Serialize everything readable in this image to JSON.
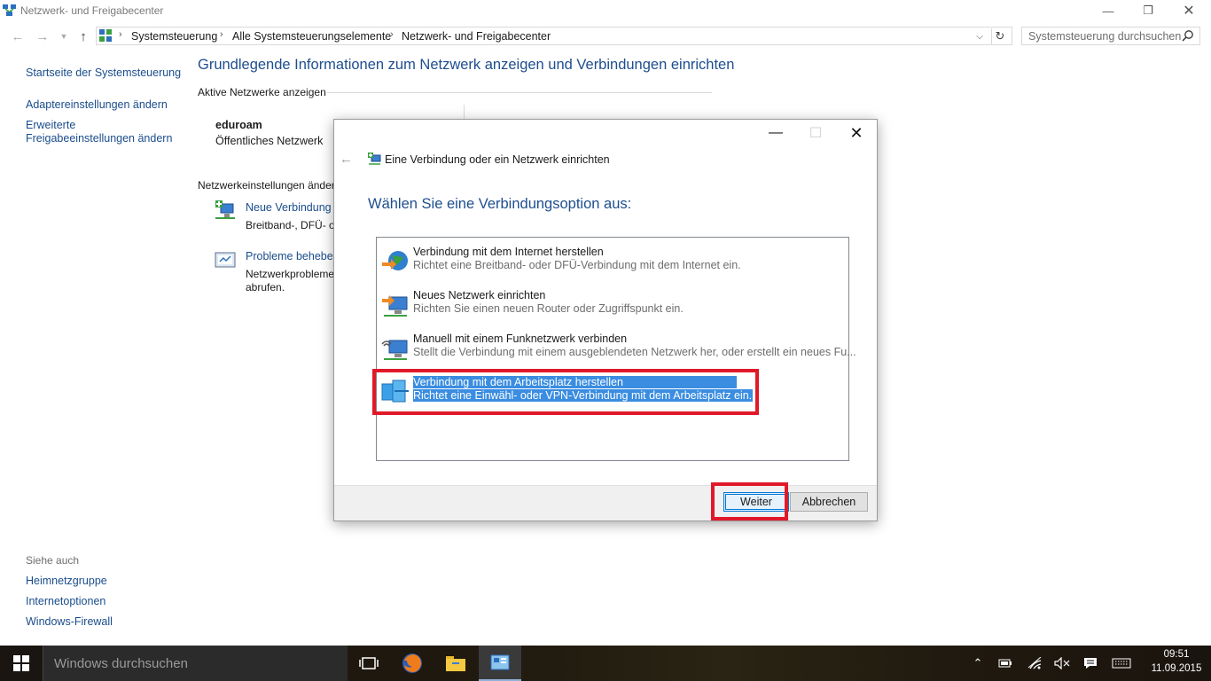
{
  "window": {
    "title": "Netzwerk- und Freigabecenter"
  },
  "address": {
    "crumbs": [
      "Systemsteuerung",
      "Alle Systemsteuerungselemente",
      "Netzwerk- und Freigabecenter"
    ],
    "search_placeholder": "Systemsteuerung durchsuchen"
  },
  "left_pane": {
    "home": "Startseite der Systemsteuerung",
    "adapter": "Adaptereinstellungen ändern",
    "advanced_line1": "Erweiterte",
    "advanced_line2": "Freigabeeinstellungen ändern",
    "see_also": "Siehe auch",
    "homegroup": "Heimnetzgruppe",
    "internet_options": "Internetoptionen",
    "firewall": "Windows-Firewall"
  },
  "main": {
    "title": "Grundlegende Informationen zum Netzwerk anzeigen und Verbindungen einrichten",
    "active_networks": "Aktive Netzwerke anzeigen",
    "network_name": "eduroam",
    "network_type": "Öffentliches Netzwerk",
    "settings_label": "Netzwerkeinstellungen änder",
    "new_conn_link": "Neue Verbindung o",
    "new_conn_desc": "Breitband-, DFÜ- o",
    "trouble_link": "Probleme beheben",
    "trouble_desc1": "Netzwerkprobleme",
    "trouble_desc2": "abrufen."
  },
  "dialog": {
    "title": "Eine Verbindung oder ein Netzwerk einrichten",
    "heading": "Wählen Sie eine Verbindungsoption aus:",
    "options": [
      {
        "title": "Verbindung mit dem Internet herstellen",
        "desc": "Richtet eine Breitband- oder DFÜ-Verbindung mit dem Internet ein.",
        "icon": "globe-icon"
      },
      {
        "title": "Neues Netzwerk einrichten",
        "desc": "Richten Sie einen neuen Router oder Zugriffspunkt ein.",
        "icon": "router-icon"
      },
      {
        "title": "Manuell mit einem Funknetzwerk verbinden",
        "desc": "Stellt die Verbindung mit einem ausgeblendeten Netzwerk her, oder erstellt ein neues Fu...",
        "icon": "wireless-icon"
      },
      {
        "title": "Verbindung mit dem Arbeitsplatz herstellen",
        "desc": "Richtet eine Einwähl- oder VPN-Verbindung mit dem Arbeitsplatz ein.",
        "icon": "workplace-icon",
        "selected": true
      }
    ],
    "next": "Weiter",
    "cancel": "Abbrechen"
  },
  "taskbar": {
    "search_placeholder": "Windows durchsuchen",
    "time": "09:51",
    "date": "11.09.2015"
  },
  "colors": {
    "accent": "#1e4e8f",
    "link": "#1a4d8c",
    "selection": "#3a8de0",
    "highlight": "#e0192a"
  }
}
